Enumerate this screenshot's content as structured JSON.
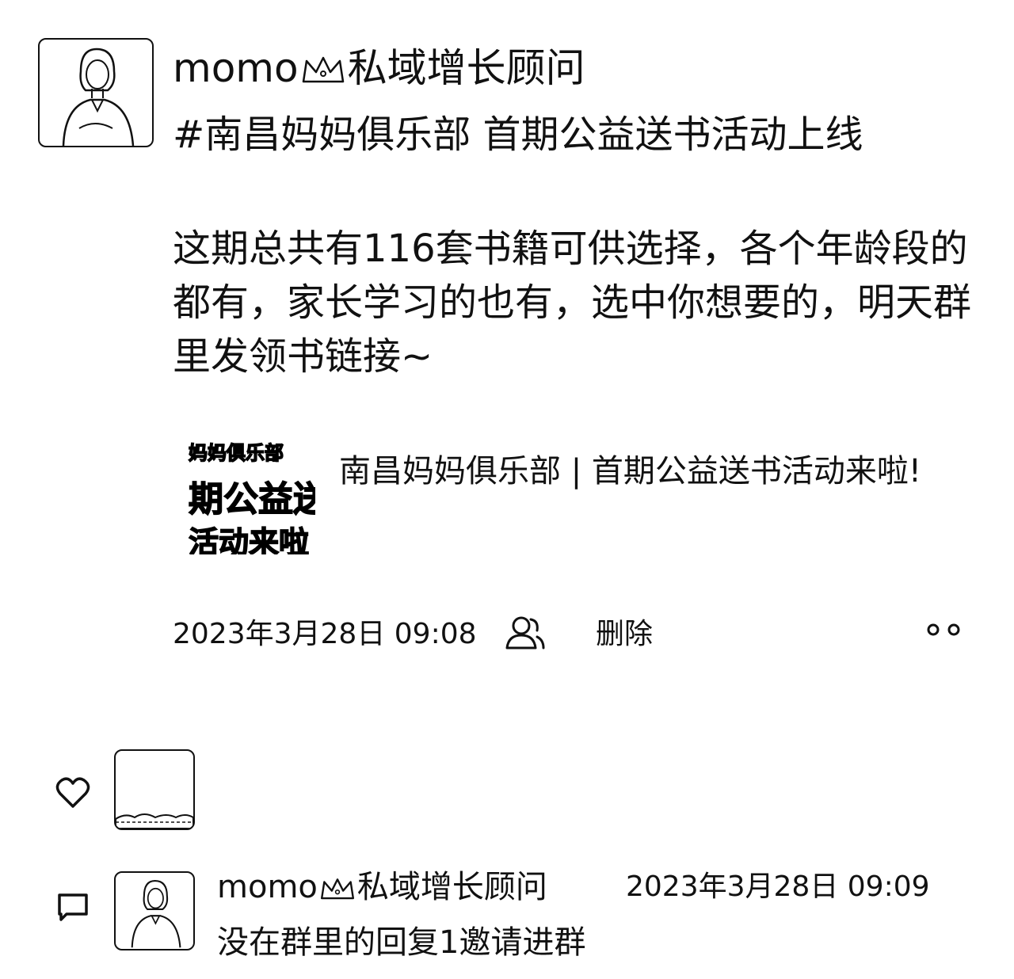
{
  "post": {
    "author": "momo",
    "author_suffix": "私域增长顾问",
    "hashtag_line": "#南昌妈妈俱乐部 首期公益送书活动上线",
    "content": "这期总共有116套书籍可供选择，各个年龄段的都有，家长学习的也有，选中你想要的，明天群里发领书链接~",
    "link": {
      "thumbnail_lines": [
        "妈妈俱乐部",
        "期公益送",
        "活动来啦"
      ],
      "title": "南昌妈妈俱乐部 | 首期公益送书活动来啦!"
    },
    "timestamp": "2023年3月28日 09:08",
    "privacy_icon": "two-people-icon",
    "delete_label": "删除",
    "more_icon": "two-dots-icon"
  },
  "likes": {
    "icon": "heart-icon"
  },
  "comments": {
    "icon": "comment-bubble-icon",
    "items": [
      {
        "author": "momo",
        "author_suffix": "私域增长顾问",
        "timestamp": "2023年3月28日 09:09",
        "text": "没在群里的回复1邀请进群"
      }
    ]
  }
}
